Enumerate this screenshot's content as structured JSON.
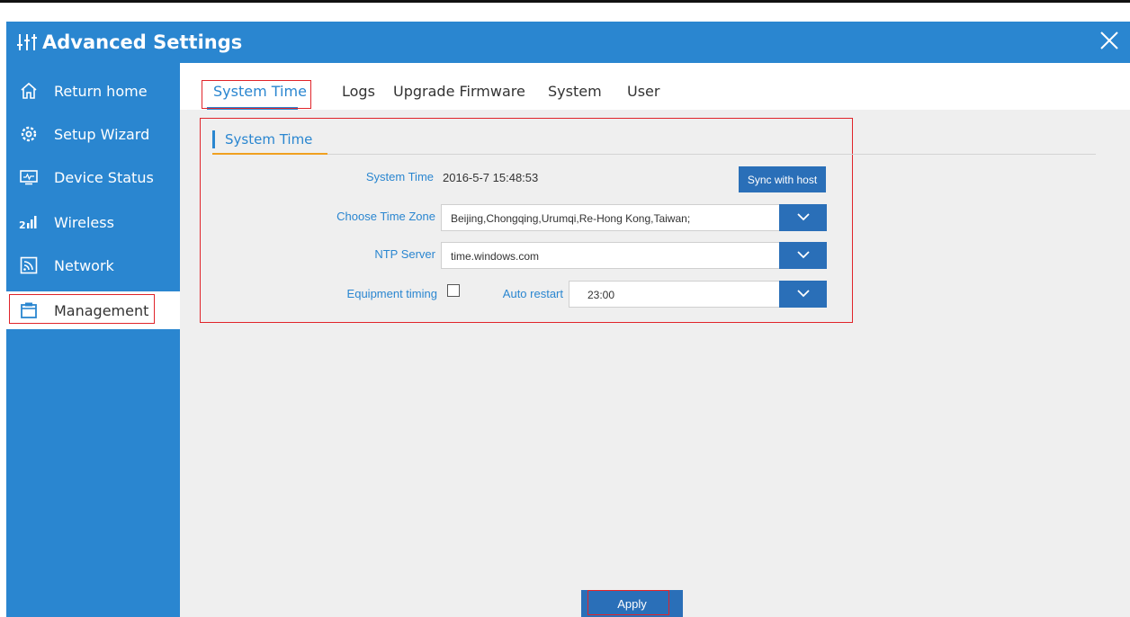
{
  "window": {
    "title": "Advanced Settings",
    "close_icon": "close-icon"
  },
  "sidebar": {
    "items": [
      {
        "label": "Return home",
        "icon": "home-icon"
      },
      {
        "label": "Setup Wizard",
        "icon": "gear-icon"
      },
      {
        "label": "Device Status",
        "icon": "monitor-icon"
      },
      {
        "label": "Wireless",
        "icon": "signal-icon"
      },
      {
        "label": "Network",
        "icon": "network-icon"
      },
      {
        "label": "Management",
        "icon": "clipboard-icon",
        "active": true
      }
    ]
  },
  "tabs": [
    {
      "label": "System Time",
      "active": true
    },
    {
      "label": "Logs"
    },
    {
      "label": "Upgrade Firmware"
    },
    {
      "label": "System"
    },
    {
      "label": "User"
    }
  ],
  "section": {
    "title": "System Time"
  },
  "form": {
    "system_time_label": "System Time",
    "system_time_value": "2016-5-7 15:48:53",
    "sync_button": "Sync with host",
    "timezone_label": "Choose Time Zone",
    "timezone_value": "Beijing,Chongqing,Urumqi,Re-Hong Kong,Taiwan;",
    "ntp_label": "NTP Server",
    "ntp_value": "time.windows.com",
    "equipment_timing_label": "Equipment timing",
    "equipment_timing_checked": false,
    "auto_restart_label": "Auto restart",
    "auto_restart_value": "23:00"
  },
  "footer": {
    "apply_label": "Apply"
  },
  "colors": {
    "primary": "#2a86d0",
    "button": "#2a6fb8",
    "highlight_border": "#e0242a",
    "accent": "#f0a020",
    "content_bg": "#efefef"
  }
}
